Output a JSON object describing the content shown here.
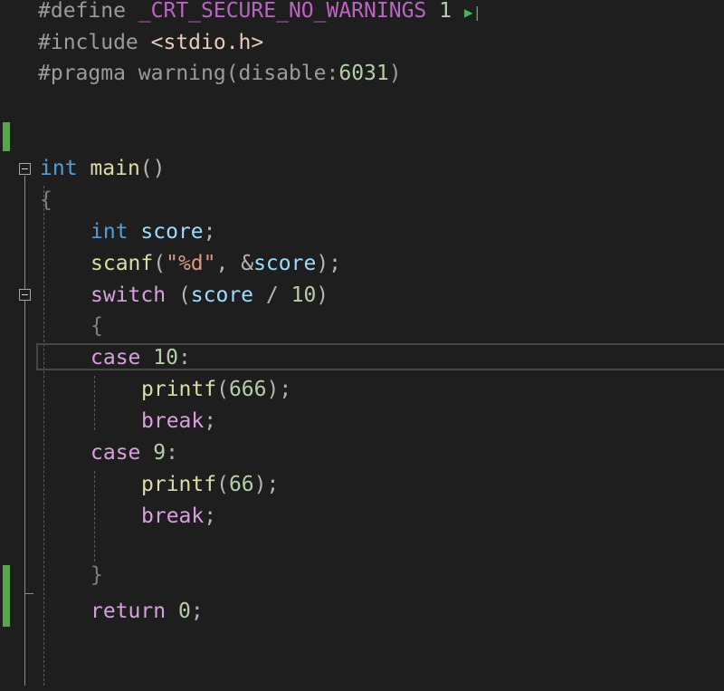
{
  "code": {
    "l1": {
      "prefix": "#define ",
      "name": "_CRT_SECURE_NO_WARNINGS",
      "value": "1"
    },
    "l2": {
      "prefix": "#include ",
      "header": "<stdio.h>"
    },
    "l3": {
      "prefix": "#pragma warning(disable:",
      "num": "6031",
      "close": ")"
    },
    "l6": {
      "type": "int",
      "name": "main",
      "parens": "()"
    },
    "l7": {
      "brace": "{"
    },
    "l8": {
      "type": "int",
      "var": "score",
      "semi": ";"
    },
    "l9": {
      "fn": "scanf",
      "open": "(",
      "str": "\"%d\"",
      "comma": ", ",
      "amp": "&",
      "var": "score",
      "close": ");"
    },
    "l10": {
      "kw": "switch",
      "open": " (",
      "var": "score",
      "op": " / ",
      "num": "10",
      "close": ")"
    },
    "l11": {
      "brace": "{"
    },
    "l12": {
      "kw": "case",
      "num": "10",
      "colon": ":"
    },
    "l13": {
      "fn": "printf",
      "open": "(",
      "num": "666",
      "close": ");"
    },
    "l14": {
      "kw": "break",
      "semi": ";"
    },
    "l15": {
      "kw": "case",
      "num": "9",
      "colon": ":"
    },
    "l16": {
      "fn": "printf",
      "open": "(",
      "num": "66",
      "close": ");"
    },
    "l17": {
      "kw": "break",
      "semi": ";"
    },
    "l19": {
      "brace": "}"
    },
    "l20": {
      "kw": "return",
      "num": "0",
      "semi": ";"
    }
  },
  "run_icon_glyph": "▶|"
}
